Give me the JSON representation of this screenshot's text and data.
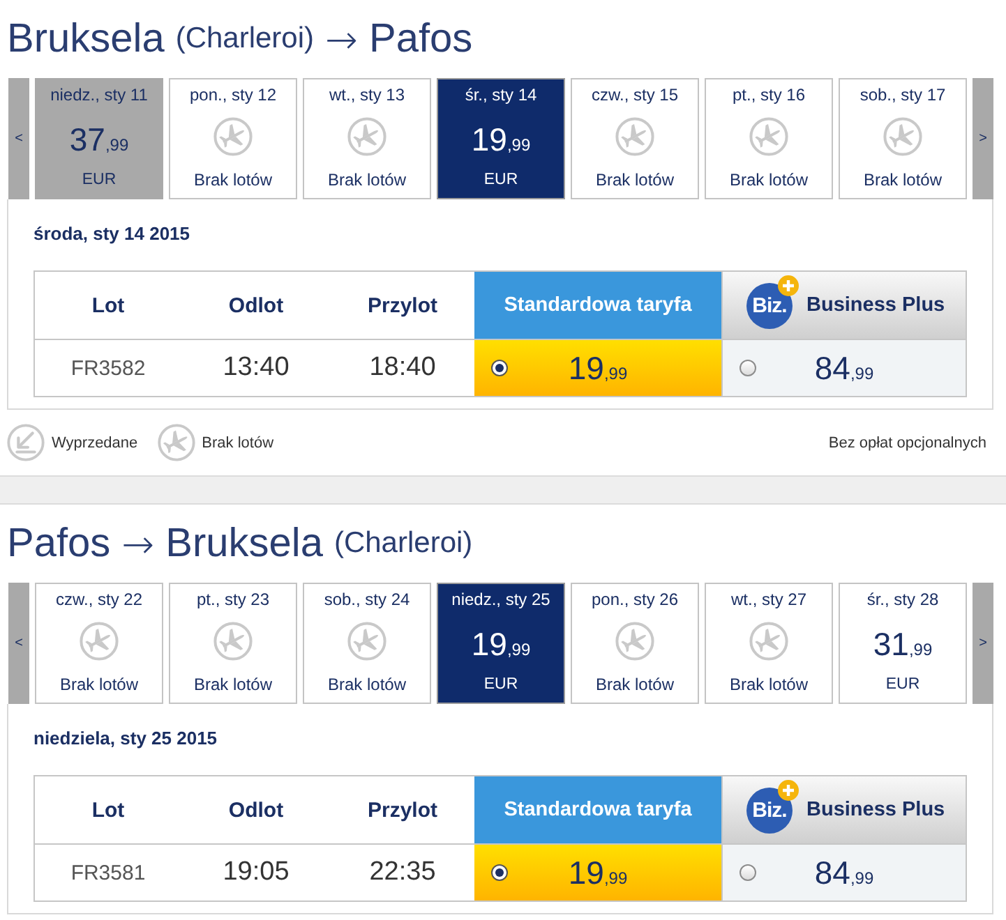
{
  "journeys": [
    {
      "title": [
        {
          "kind": "city",
          "text": "Bruksela"
        },
        {
          "kind": "airport",
          "text": "(Charleroi)"
        },
        {
          "kind": "arrow",
          "text": "→"
        },
        {
          "kind": "city",
          "text": "Pafos"
        }
      ],
      "strip": {
        "prev": "<",
        "next": ">",
        "days": [
          {
            "label": "niedz., sty 11",
            "kind": "fare",
            "amount": "37",
            "decimals": ",99",
            "currency": "EUR",
            "selected": false,
            "disabled": true
          },
          {
            "label": "pon., sty 12",
            "kind": "no_flights",
            "note": "Brak lotów",
            "selected": false,
            "disabled": false
          },
          {
            "label": "wt., sty 13",
            "kind": "no_flights",
            "note": "Brak lotów",
            "selected": false,
            "disabled": false
          },
          {
            "label": "śr., sty 14",
            "kind": "fare",
            "amount": "19",
            "decimals": ",99",
            "currency": "EUR",
            "selected": true,
            "disabled": false
          },
          {
            "label": "czw., sty 15",
            "kind": "no_flights",
            "note": "Brak lotów",
            "selected": false,
            "disabled": false
          },
          {
            "label": "pt., sty 16",
            "kind": "no_flights",
            "note": "Brak lotów",
            "selected": false,
            "disabled": false
          },
          {
            "label": "sob., sty 17",
            "kind": "no_flights",
            "note": "Brak lotów",
            "selected": false,
            "disabled": false
          }
        ]
      },
      "date_heading": "środa, sty 14 2015",
      "table": {
        "columns": [
          {
            "kind": "plain",
            "label": "Lot"
          },
          {
            "kind": "plain",
            "label": "Odlot"
          },
          {
            "kind": "plain",
            "label": "Przylot"
          },
          {
            "kind": "standard",
            "label": "Standardowa taryfa"
          },
          {
            "kind": "business",
            "label": "Business Plus",
            "logo": "Biz."
          }
        ],
        "rows": [
          {
            "flight": "FR3582",
            "departure": "13:40",
            "arrival": "18:40",
            "fares": [
              {
                "kind": "standard",
                "amount": "19",
                "decimals": ",99",
                "selected": true
              },
              {
                "kind": "business",
                "amount": "84",
                "decimals": ",99",
                "selected": false
              }
            ]
          }
        ]
      },
      "legend": [
        {
          "kind": "sold_out",
          "label": "Wyprzedane"
        },
        {
          "kind": "no_flights",
          "label": "Brak lotów"
        }
      ],
      "legend_note": "Bez opłat opcjonalnych"
    },
    {
      "title": [
        {
          "kind": "city",
          "text": "Pafos"
        },
        {
          "kind": "arrow",
          "text": "→"
        },
        {
          "kind": "city",
          "text": "Bruksela"
        },
        {
          "kind": "airport",
          "text": "(Charleroi)"
        }
      ],
      "strip": {
        "prev": "<",
        "next": ">",
        "days": [
          {
            "label": "czw., sty 22",
            "kind": "no_flights",
            "note": "Brak lotów",
            "selected": false,
            "disabled": false
          },
          {
            "label": "pt., sty 23",
            "kind": "no_flights",
            "note": "Brak lotów",
            "selected": false,
            "disabled": false
          },
          {
            "label": "sob., sty 24",
            "kind": "no_flights",
            "note": "Brak lotów",
            "selected": false,
            "disabled": false
          },
          {
            "label": "niedz., sty 25",
            "kind": "fare",
            "amount": "19",
            "decimals": ",99",
            "currency": "EUR",
            "selected": true,
            "disabled": false
          },
          {
            "label": "pon., sty 26",
            "kind": "no_flights",
            "note": "Brak lotów",
            "selected": false,
            "disabled": false
          },
          {
            "label": "wt., sty 27",
            "kind": "no_flights",
            "note": "Brak lotów",
            "selected": false,
            "disabled": false
          },
          {
            "label": "śr., sty 28",
            "kind": "fare",
            "amount": "31",
            "decimals": ",99",
            "currency": "EUR",
            "selected": false,
            "disabled": false
          }
        ]
      },
      "date_heading": "niedziela, sty 25 2015",
      "table": {
        "columns": [
          {
            "kind": "plain",
            "label": "Lot"
          },
          {
            "kind": "plain",
            "label": "Odlot"
          },
          {
            "kind": "plain",
            "label": "Przylot"
          },
          {
            "kind": "standard",
            "label": "Standardowa taryfa"
          },
          {
            "kind": "business",
            "label": "Business Plus",
            "logo": "Biz."
          }
        ],
        "rows": [
          {
            "flight": "FR3581",
            "departure": "19:05",
            "arrival": "22:35",
            "fares": [
              {
                "kind": "standard",
                "amount": "19",
                "decimals": ",99",
                "selected": true
              },
              {
                "kind": "business",
                "amount": "84",
                "decimals": ",99",
                "selected": false
              }
            ]
          }
        ]
      }
    }
  ]
}
